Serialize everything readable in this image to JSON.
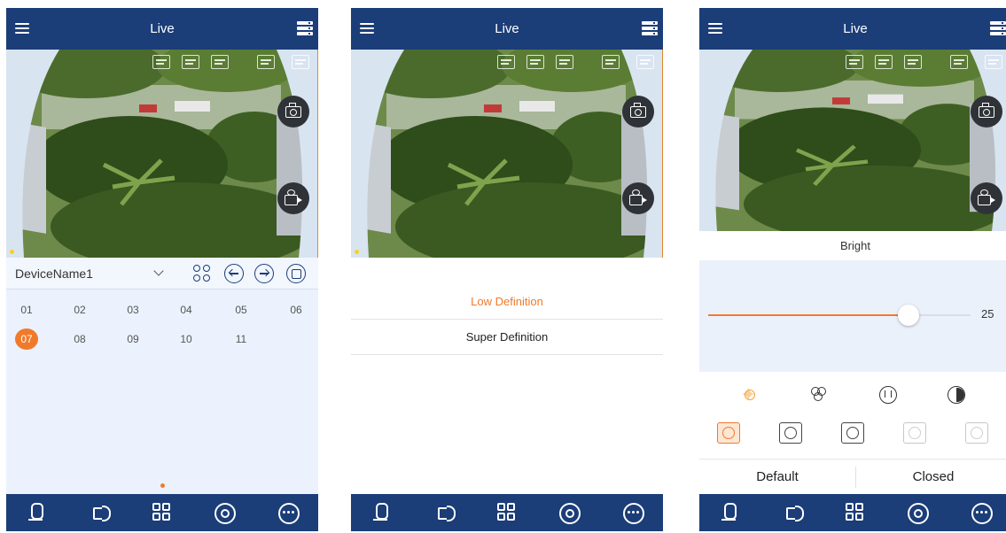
{
  "header": {
    "title": "Live"
  },
  "screen1": {
    "device_name": "DeviceName1",
    "channels": [
      "01",
      "02",
      "03",
      "04",
      "05",
      "06",
      "07",
      "08",
      "09",
      "10",
      "11"
    ],
    "selected_channel": "07"
  },
  "screen2": {
    "options": [
      "Low Definition",
      "Super Definition"
    ],
    "selected_option": "Low Definition"
  },
  "screen3": {
    "adjust_label": "Bright",
    "slider_value": 25,
    "slider_max": 100,
    "default_label": "Default",
    "closed_label": "Closed"
  },
  "colors": {
    "header_bg": "#1b3d78",
    "accent": "#f07a2c",
    "panel_bg": "#ebf2fd"
  },
  "icons": {
    "header": [
      "menu-icon",
      "device-list-icon"
    ],
    "video": [
      "ptz-icon",
      "adjust-icon",
      "record-settings-icon",
      "zoom-icon",
      "fullscreen-icon",
      "snapshot-icon",
      "record-icon"
    ],
    "bottom": [
      "microphone-icon",
      "speaker-icon",
      "layout-grid-icon",
      "ptz-control-icon",
      "more-icon"
    ]
  }
}
